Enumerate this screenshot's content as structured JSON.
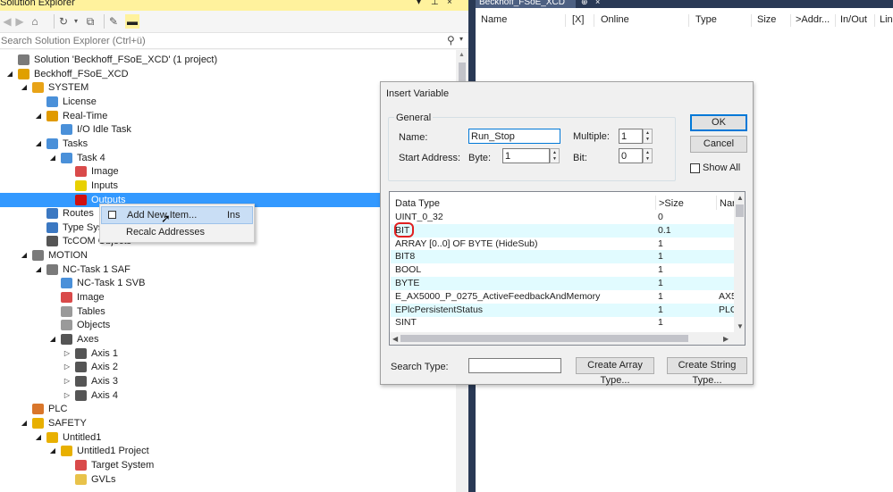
{
  "solution_explorer": {
    "title": "Solution Explorer",
    "pin": "▾ ⊥ ×",
    "search_placeholder": "Search Solution Explorer (Ctrl+ü)",
    "tree": [
      {
        "label": "Solution 'Beckhoff_FSoE_XCD' (1 project)",
        "icon": "solution-icon",
        "color": "#7a7a7a",
        "level": 0,
        "exp": ""
      },
      {
        "label": "Beckhoff_FSoE_XCD",
        "icon": "project-icon",
        "color": "#e0a000",
        "level": 0,
        "exp": "◢"
      },
      {
        "label": "SYSTEM",
        "icon": "system-icon",
        "color": "#e8a317",
        "level": 1,
        "exp": "◢"
      },
      {
        "label": "License",
        "icon": "license-icon",
        "color": "#4a90d9",
        "level": 2,
        "exp": ""
      },
      {
        "label": "Real-Time",
        "icon": "clock-icon",
        "color": "#e09a00",
        "level": 2,
        "exp": "◢"
      },
      {
        "label": "I/O Idle Task",
        "icon": "task-icon",
        "color": "#4a90d9",
        "level": 3,
        "exp": ""
      },
      {
        "label": "Tasks",
        "icon": "tasks-icon",
        "color": "#4a90d9",
        "level": 2,
        "exp": "◢"
      },
      {
        "label": "Task 4",
        "icon": "task-icon",
        "color": "#4a90d9",
        "level": 3,
        "exp": "◢"
      },
      {
        "label": "Image",
        "icon": "image-icon",
        "color": "#d94a4a",
        "level": 4,
        "exp": ""
      },
      {
        "label": "Inputs",
        "icon": "inputs-icon",
        "color": "#e8d000",
        "level": 4,
        "exp": ""
      },
      {
        "label": "Outputs",
        "icon": "outputs-icon",
        "color": "#d01010",
        "level": 4,
        "exp": "",
        "selected": true
      },
      {
        "label": "Routes",
        "icon": "routes-icon",
        "color": "#3b78c2",
        "level": 2,
        "exp": ""
      },
      {
        "label": "Type Sys",
        "icon": "typesys-icon",
        "color": "#3b78c2",
        "level": 2,
        "exp": ""
      },
      {
        "label": "TcCOM Objects",
        "icon": "tccom-icon",
        "color": "#555555",
        "level": 2,
        "exp": ""
      },
      {
        "label": "MOTION",
        "icon": "motion-icon",
        "color": "#7a7a7a",
        "level": 1,
        "exp": "◢"
      },
      {
        "label": "NC-Task 1 SAF",
        "icon": "nc-task-icon",
        "color": "#7a7a7a",
        "level": 2,
        "exp": "◢"
      },
      {
        "label": "NC-Task 1 SVB",
        "icon": "task-icon",
        "color": "#4a90d9",
        "level": 3,
        "exp": ""
      },
      {
        "label": "Image",
        "icon": "image-icon",
        "color": "#d94a4a",
        "level": 3,
        "exp": ""
      },
      {
        "label": "Tables",
        "icon": "tables-icon",
        "color": "#9a9a9a",
        "level": 3,
        "exp": ""
      },
      {
        "label": "Objects",
        "icon": "objects-icon",
        "color": "#9a9a9a",
        "level": 3,
        "exp": ""
      },
      {
        "label": "Axes",
        "icon": "axes-icon",
        "color": "#555555",
        "level": 3,
        "exp": "◢"
      },
      {
        "label": "Axis 1",
        "icon": "axis-icon",
        "color": "#555555",
        "level": 4,
        "exp": "▷"
      },
      {
        "label": "Axis 2",
        "icon": "axis-icon",
        "color": "#555555",
        "level": 4,
        "exp": "▷"
      },
      {
        "label": "Axis 3",
        "icon": "axis-icon",
        "color": "#555555",
        "level": 4,
        "exp": "▷"
      },
      {
        "label": "Axis 4",
        "icon": "axis-icon",
        "color": "#555555",
        "level": 4,
        "exp": "▷"
      },
      {
        "label": "PLC",
        "icon": "plc-icon",
        "color": "#d9762b",
        "level": 1,
        "exp": ""
      },
      {
        "label": "SAFETY",
        "icon": "safety-icon",
        "color": "#e8b000",
        "level": 1,
        "exp": "◢"
      },
      {
        "label": "Untitled1",
        "icon": "safety-project-icon",
        "color": "#e8b000",
        "level": 2,
        "exp": "◢"
      },
      {
        "label": "Untitled1 Project",
        "icon": "safety-project-icon",
        "color": "#e8b000",
        "level": 3,
        "exp": "◢"
      },
      {
        "label": "Target System",
        "icon": "target-icon",
        "color": "#d94a4a",
        "level": 4,
        "exp": ""
      },
      {
        "label": "GVLs",
        "icon": "folder-icon",
        "color": "#e8c24a",
        "level": 4,
        "exp": ""
      }
    ]
  },
  "context_menu": {
    "items": [
      {
        "label": "Add New Item...",
        "shortcut": "Ins"
      },
      {
        "label": "Recalc Addresses",
        "shortcut": ""
      }
    ]
  },
  "right_panel": {
    "tab_title": "Beckhoff_FSoE_XCD",
    "tab_pin": "⊕",
    "tab_close": "×",
    "columns": [
      "Name",
      "[X]",
      "Online",
      "Type",
      "Size",
      ">Addr...",
      "In/Out",
      "Lin"
    ]
  },
  "dialog": {
    "title": "Insert Variable",
    "group_label": "General",
    "name_label": "Name:",
    "name_value": "Run_Stop",
    "multiple_label": "Multiple:",
    "multiple_value": "1",
    "start_address_label": "Start Address:",
    "byte_label": "Byte:",
    "byte_value": "1",
    "bit_label": "Bit:",
    "bit_value": "0",
    "ok": "OK",
    "cancel": "Cancel",
    "show_all": "Show All",
    "list_headers": [
      "Data Type",
      ">Size",
      "Nar"
    ],
    "data_types": [
      {
        "type": "UINT_0_32",
        "size": "0",
        "name": ""
      },
      {
        "type": "BIT",
        "size": "0.1",
        "name": ""
      },
      {
        "type": "ARRAY [0..0] OF BYTE (HideSub)",
        "size": "1",
        "name": ""
      },
      {
        "type": "BIT8",
        "size": "1",
        "name": ""
      },
      {
        "type": "BOOL",
        "size": "1",
        "name": ""
      },
      {
        "type": "BYTE",
        "size": "1",
        "name": ""
      },
      {
        "type": "E_AX5000_P_0275_ActiveFeedbackAndMemory",
        "size": "1",
        "name": "AX5"
      },
      {
        "type": "EPlcPersistentStatus",
        "size": "1",
        "name": "PLC"
      },
      {
        "type": "SINT",
        "size": "1",
        "name": ""
      }
    ],
    "search_type_label": "Search Type:",
    "search_type_value": "",
    "create_array": "Create Array Type...",
    "create_string": "Create String Type..."
  }
}
